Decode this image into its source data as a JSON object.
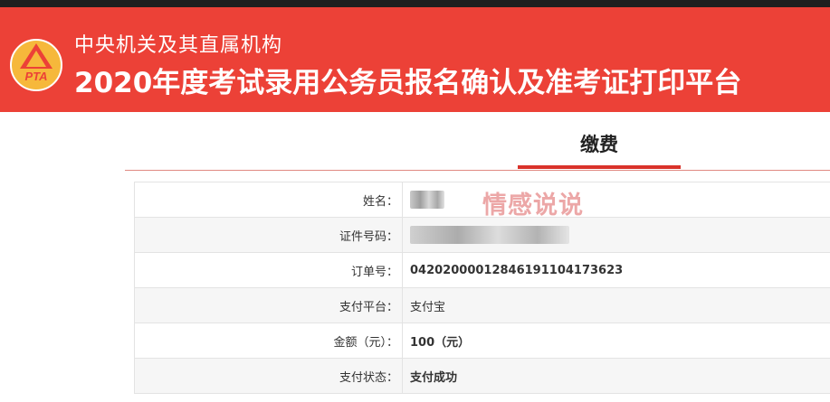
{
  "header": {
    "logo_text": "PTA",
    "subtitle": "中央机关及其直属机构",
    "title": "2020年度考试录用公务员报名确认及准考证打印平台"
  },
  "section": {
    "title": "缴费"
  },
  "rows": [
    {
      "label": "姓名：",
      "value": ""
    },
    {
      "label": "证件号码：",
      "value": ""
    },
    {
      "label": "订单号：",
      "value": "042020000128461911041736​23"
    },
    {
      "label": "支付平台：",
      "value": "支付宝"
    },
    {
      "label": "金额（元）：",
      "value": "100",
      "suffix": "（元）"
    },
    {
      "label": "支付状态：",
      "value": "支付成功"
    }
  ],
  "watermark": "情感说说",
  "colors": {
    "banner": "#ec4137",
    "accent": "#d9211c"
  }
}
